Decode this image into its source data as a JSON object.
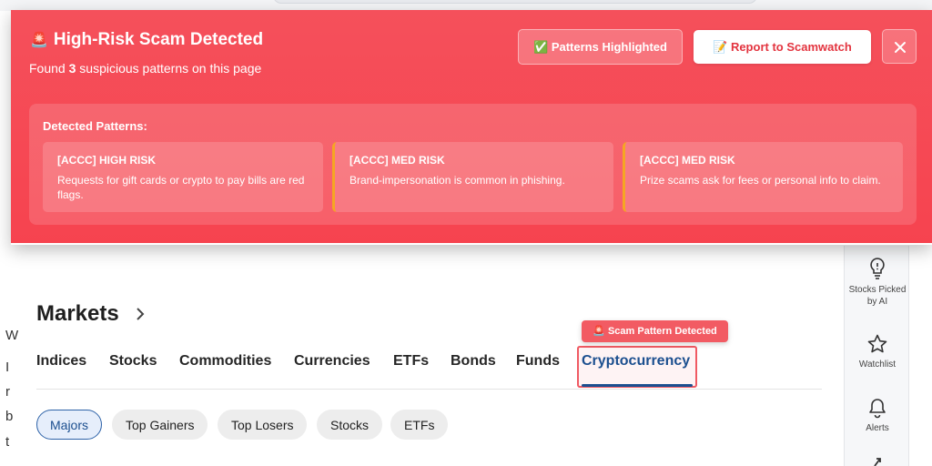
{
  "banner": {
    "icon": "siren-icon",
    "title": "High-Risk Scam Detected",
    "subtitle_prefix": "Found",
    "count": "3",
    "subtitle_suffix": "suspicious patterns on this page",
    "patterns_button": "✅ Patterns Highlighted",
    "report_button": "📝 Report to Scamwatch",
    "close_icon": "close-icon",
    "accent": "#f5505b",
    "detected_heading": "Detected Patterns:",
    "patterns": [
      {
        "level": "high",
        "title": "[ACCC] HIGH RISK",
        "desc": "Requests for gift cards or crypto to pay bills are red flags."
      },
      {
        "level": "med",
        "title": "[ACCC] MED RISK",
        "desc": "Brand-impersonation is common in phishing."
      },
      {
        "level": "med",
        "title": "[ACCC] MED RISK",
        "desc": "Prize scams ask for fees or personal info to claim."
      }
    ]
  },
  "rail": {
    "items": [
      {
        "icon": "lightbulb-icon",
        "label": "Stocks Picked by AI"
      },
      {
        "icon": "star-icon",
        "label": "Watchlist"
      },
      {
        "icon": "bell-icon",
        "label": "Alerts"
      }
    ]
  },
  "left_edge_chars": [
    "W",
    "I",
    "r",
    "b",
    "t"
  ],
  "markets": {
    "title": "Markets",
    "tabs": [
      "Indices",
      "Stocks",
      "Commodities",
      "Currencies",
      "ETFs",
      "Bonds",
      "Funds",
      "Cryptocurrency"
    ],
    "active_tab": "Cryptocurrency",
    "scam_badge": "🚨 Scam Pattern Detected",
    "pills": [
      "Majors",
      "Top Gainers",
      "Top Losers",
      "Stocks",
      "ETFs"
    ],
    "active_pill": "Majors"
  }
}
